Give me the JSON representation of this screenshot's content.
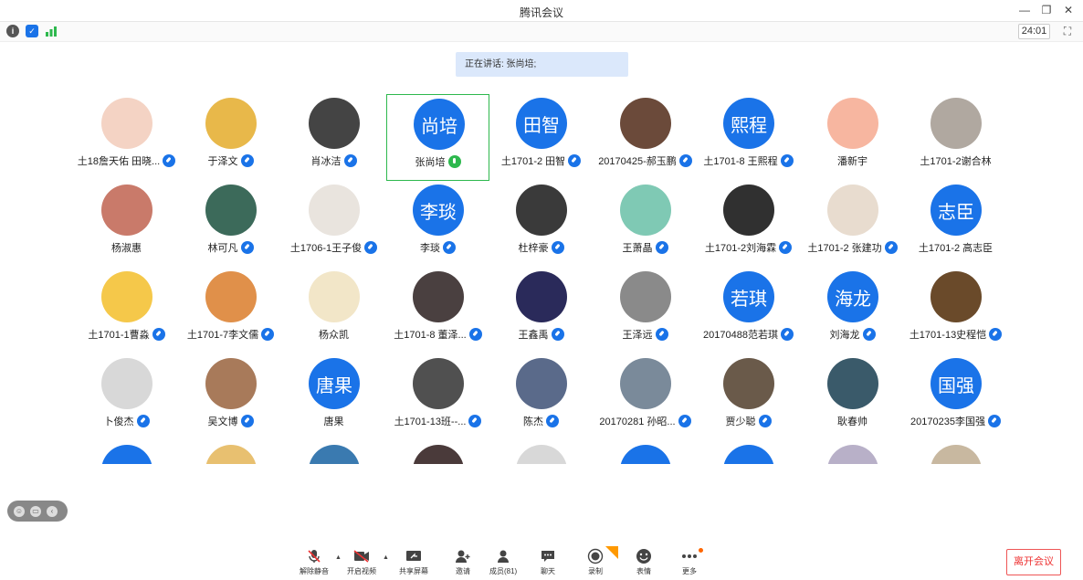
{
  "window": {
    "title": "腾讯会议"
  },
  "status": {
    "timer": "24:01"
  },
  "banner": {
    "speaking": "正在讲话: 张尚培;"
  },
  "tiles": [
    {
      "name": "土18詹天佑 田晓...",
      "avatar_text": "",
      "color": "#f4d3c4",
      "mic": "on"
    },
    {
      "name": "于泽文",
      "avatar_text": "",
      "color": "#e8b84a",
      "mic": "on"
    },
    {
      "name": "肖冰洁",
      "avatar_text": "",
      "color": "#444444",
      "mic": "on"
    },
    {
      "name": "张尚培",
      "avatar_text": "尚培",
      "color": "#1a73e8",
      "mic": "speak"
    },
    {
      "name": "土1701-2 田智",
      "avatar_text": "田智",
      "color": "#1a73e8",
      "mic": "on"
    },
    {
      "name": "20170425-郝玉鹏",
      "avatar_text": "",
      "color": "#6b4a3a",
      "mic": "on"
    },
    {
      "name": "土1701-8 王熙程",
      "avatar_text": "熙程",
      "color": "#1a73e8",
      "mic": "on"
    },
    {
      "name": "潘新宇",
      "avatar_text": "",
      "color": "#f7b6a0",
      "mic": "none"
    },
    {
      "name": "土1701-2谢合林",
      "avatar_text": "",
      "color": "#b0a8a0",
      "mic": "none"
    },
    {
      "name": "杨淑惠",
      "avatar_text": "",
      "color": "#c97a6a",
      "mic": "none"
    },
    {
      "name": "林可凡",
      "avatar_text": "",
      "color": "#3c6a5a",
      "mic": "on"
    },
    {
      "name": "土1706-1王子俊",
      "avatar_text": "",
      "color": "#e9e4de",
      "mic": "on"
    },
    {
      "name": "李琰",
      "avatar_text": "李琰",
      "color": "#1a73e8",
      "mic": "on"
    },
    {
      "name": "杜梓豪",
      "avatar_text": "",
      "color": "#3a3a3a",
      "mic": "on"
    },
    {
      "name": "王萧晶",
      "avatar_text": "",
      "color": "#7fc9b4",
      "mic": "on"
    },
    {
      "name": "土1701-2刘海霖",
      "avatar_text": "",
      "color": "#303030",
      "mic": "on"
    },
    {
      "name": "土1701-2 张建功",
      "avatar_text": "",
      "color": "#e8dccf",
      "mic": "on"
    },
    {
      "name": "土1701-2 高志臣",
      "avatar_text": "志臣",
      "color": "#1a73e8",
      "mic": "none"
    },
    {
      "name": "土1701-1曹淼",
      "avatar_text": "",
      "color": "#f5c84a",
      "mic": "on"
    },
    {
      "name": "土1701-7李文儒",
      "avatar_text": "",
      "color": "#e0904a",
      "mic": "on"
    },
    {
      "name": "杨众凯",
      "avatar_text": "",
      "color": "#f2e6c8",
      "mic": "none"
    },
    {
      "name": "土1701-8 董泽...",
      "avatar_text": "",
      "color": "#4a4040",
      "mic": "on"
    },
    {
      "name": "王鑫禹",
      "avatar_text": "",
      "color": "#2a2a5a",
      "mic": "on"
    },
    {
      "name": "王泽远",
      "avatar_text": "",
      "color": "#8a8a8a",
      "mic": "on"
    },
    {
      "name": "20170488范若琪",
      "avatar_text": "若琪",
      "color": "#1a73e8",
      "mic": "on"
    },
    {
      "name": "刘海龙",
      "avatar_text": "海龙",
      "color": "#1a73e8",
      "mic": "on"
    },
    {
      "name": "土1701-13史程恺",
      "avatar_text": "",
      "color": "#6a4a2a",
      "mic": "on"
    },
    {
      "name": "卜俊杰",
      "avatar_text": "",
      "color": "#d8d8d8",
      "mic": "on"
    },
    {
      "name": "吴文博",
      "avatar_text": "",
      "color": "#a87a5a",
      "mic": "on"
    },
    {
      "name": "唐果",
      "avatar_text": "唐果",
      "color": "#1a73e8",
      "mic": "none"
    },
    {
      "name": "土1701-13班--...",
      "avatar_text": "",
      "color": "#505050",
      "mic": "on"
    },
    {
      "name": "陈杰",
      "avatar_text": "",
      "color": "#5a6a8a",
      "mic": "on"
    },
    {
      "name": "20170281 孙昭...",
      "avatar_text": "",
      "color": "#7a8a9a",
      "mic": "on"
    },
    {
      "name": "贾少聪",
      "avatar_text": "",
      "color": "#6a5a4a",
      "mic": "on"
    },
    {
      "name": "耿春帅",
      "avatar_text": "",
      "color": "#3a5a6a",
      "mic": "none"
    },
    {
      "name": "20170235李国强",
      "avatar_text": "国强",
      "color": "#1a73e8",
      "mic": "on"
    },
    {
      "name": "",
      "avatar_text": "",
      "color": "#1a73e8",
      "mic": "none"
    },
    {
      "name": "",
      "avatar_text": "",
      "color": "#e8c070",
      "mic": "none"
    },
    {
      "name": "",
      "avatar_text": "",
      "color": "#3a7ab0",
      "mic": "none"
    },
    {
      "name": "",
      "avatar_text": "",
      "color": "#4a3a3a",
      "mic": "none"
    },
    {
      "name": "",
      "avatar_text": "",
      "color": "#d8d8d8",
      "mic": "none"
    },
    {
      "name": "",
      "avatar_text": "",
      "color": "#1a73e8",
      "mic": "none"
    },
    {
      "name": "",
      "avatar_text": "",
      "color": "#1a73e8",
      "mic": "none"
    },
    {
      "name": "",
      "avatar_text": "",
      "color": "#b8b0c8",
      "mic": "none"
    },
    {
      "name": "",
      "avatar_text": "",
      "color": "#c8b8a0",
      "mic": "none"
    }
  ],
  "toolbar": {
    "unmute": "解除静音",
    "video": "开启视频",
    "share": "共享屏幕",
    "invite": "邀请",
    "members": "成员(81)",
    "chat": "聊天",
    "record": "录制",
    "emoji": "表情",
    "more": "更多",
    "leave": "离开会议"
  },
  "colors": {
    "accent": "#1a73e8",
    "speaking": "#2db84d",
    "leave": "#e33333"
  }
}
